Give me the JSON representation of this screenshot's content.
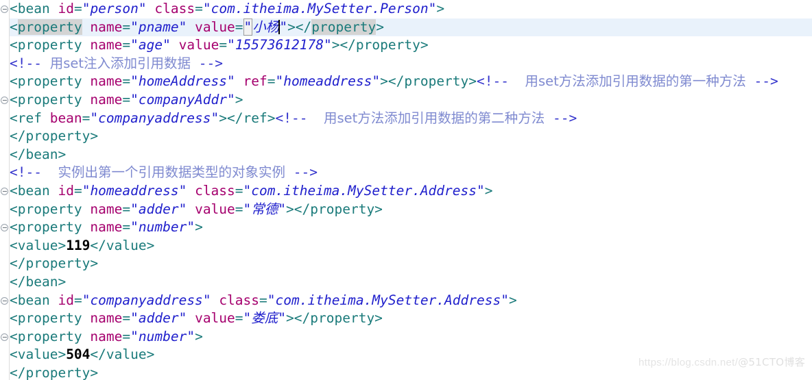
{
  "editor": {
    "language": "XML",
    "font_size_px": 19.5,
    "line_height_px": 26.6,
    "colors": {
      "background": "#ffffff",
      "tag": "#1a7a7a",
      "attribute_name": "#a5006e",
      "attribute_value": "#2020cc",
      "comment_marker": "#3333cc",
      "comment_text": "#7f8ad0",
      "text_content": "#000000",
      "current_line_highlight": "#e9f2fb",
      "bracket_match_highlight": "#d4d4d4",
      "gutter_border": "#dcdcdc"
    },
    "current_line_number": 2,
    "fold_marker_lines": [
      1,
      6,
      12,
      14,
      17,
      19
    ],
    "caret_line": 2
  },
  "lines": [
    {
      "n": 1,
      "fold": true,
      "tokens": [
        {
          "t": "tag",
          "s": "<bean "
        },
        {
          "t": "attr",
          "s": "id"
        },
        {
          "t": "tag",
          "s": "="
        },
        {
          "t": "val",
          "s": "\"person\""
        },
        {
          "t": "tag",
          "s": " "
        },
        {
          "t": "attr",
          "s": "class"
        },
        {
          "t": "tag",
          "s": "="
        },
        {
          "t": "val",
          "s": "\"com.itheima.MySetter.Person\""
        },
        {
          "t": "tag",
          "s": ">"
        }
      ],
      "plain": "<bean id=\"person\" class=\"com.itheima.MySetter.Person\">"
    },
    {
      "n": 2,
      "current": true,
      "plain": "<property name=\"pname\" value=\"小杨\"></property>"
    },
    {
      "n": 3,
      "plain": "<property name=\"age\" value=\"15573612178\"></property>"
    },
    {
      "n": 4,
      "plain": "<!-- 用set注入添加引用数据 -->",
      "comment_text": "用set注入添加引用数据"
    },
    {
      "n": 5,
      "plain": "<property name=\"homeAddress\" ref=\"homeaddress\"></property><!-- 用set方法添加引用数据的第一种方法 -->",
      "comment_text": "用set方法添加引用数据的第一种方法"
    },
    {
      "n": 6,
      "fold": true,
      "plain": "<property name=\"companyAddr\">"
    },
    {
      "n": 7,
      "plain": "<ref bean=\"companyaddress\"></ref><!-- 用set方法添加引用数据的第二种方法 -->",
      "comment_text": "用set方法添加引用数据的第二种方法"
    },
    {
      "n": 8,
      "plain": "</property>"
    },
    {
      "n": 9,
      "plain": "</bean>"
    },
    {
      "n": 10,
      "plain": "<!-- 实例出第一个引用数据类型的对象实例 -->",
      "comment_text": "实例出第一个引用数据类型的对象实例"
    },
    {
      "n": 11,
      "fold": true,
      "plain": "<bean id=\"homeaddress\" class=\"com.itheima.MySetter.Address\">"
    },
    {
      "n": 12,
      "plain": "<property name=\"adder\" value=\"常德\"></property>"
    },
    {
      "n": 13,
      "fold": true,
      "plain": "<property name=\"number\">"
    },
    {
      "n": 14,
      "plain": "<value>119</value>",
      "value_text": "119"
    },
    {
      "n": 15,
      "plain": "</property>"
    },
    {
      "n": 16,
      "plain": "</bean>"
    },
    {
      "n": 17,
      "fold": true,
      "plain": "<bean id=\"companyaddress\" class=\"com.itheima.MySetter.Address\">"
    },
    {
      "n": 18,
      "plain": "<property name=\"adder\" value=\"娄底\"></property>"
    },
    {
      "n": 19,
      "fold": true,
      "plain": "<property name=\"number\">"
    },
    {
      "n": 20,
      "plain": "<value>504</value>",
      "value_text": "504"
    },
    {
      "n": 21,
      "plain": "</property>"
    }
  ],
  "text_values": {
    "line1_bean_id": "person",
    "line1_bean_class": "com.itheima.MySetter.Person",
    "line2_prop_name": "pname",
    "line2_prop_value": "小杨",
    "line3_prop_name": "age",
    "line3_prop_value": "15573612178",
    "line4_comment": "用set注入添加引用数据",
    "line5_prop_name": "homeAddress",
    "line5_prop_ref": "homeaddress",
    "line5_comment": "用set方法添加引用数据的第一种方法",
    "line6_prop_name": "companyAddr",
    "line7_ref_bean": "companyaddress",
    "line7_comment": "用set方法添加引用数据的第二种方法",
    "line10_comment": "实例出第一个引用数据类型的对象实例",
    "line11_bean_id": "homeaddress",
    "line11_bean_class": "com.itheima.MySetter.Address",
    "line12_prop_name": "adder",
    "line12_prop_value": "常德",
    "line13_prop_name": "number",
    "line14_value": "119",
    "line17_bean_id": "companyaddress",
    "line17_bean_class": "com.itheima.MySetter.Address",
    "line18_prop_name": "adder",
    "line18_prop_value": "娄底",
    "line19_prop_name": "number",
    "line20_value": "504"
  },
  "watermark": {
    "url": "https://blog.csdn.net/",
    "handle": "@51CTO博客"
  }
}
